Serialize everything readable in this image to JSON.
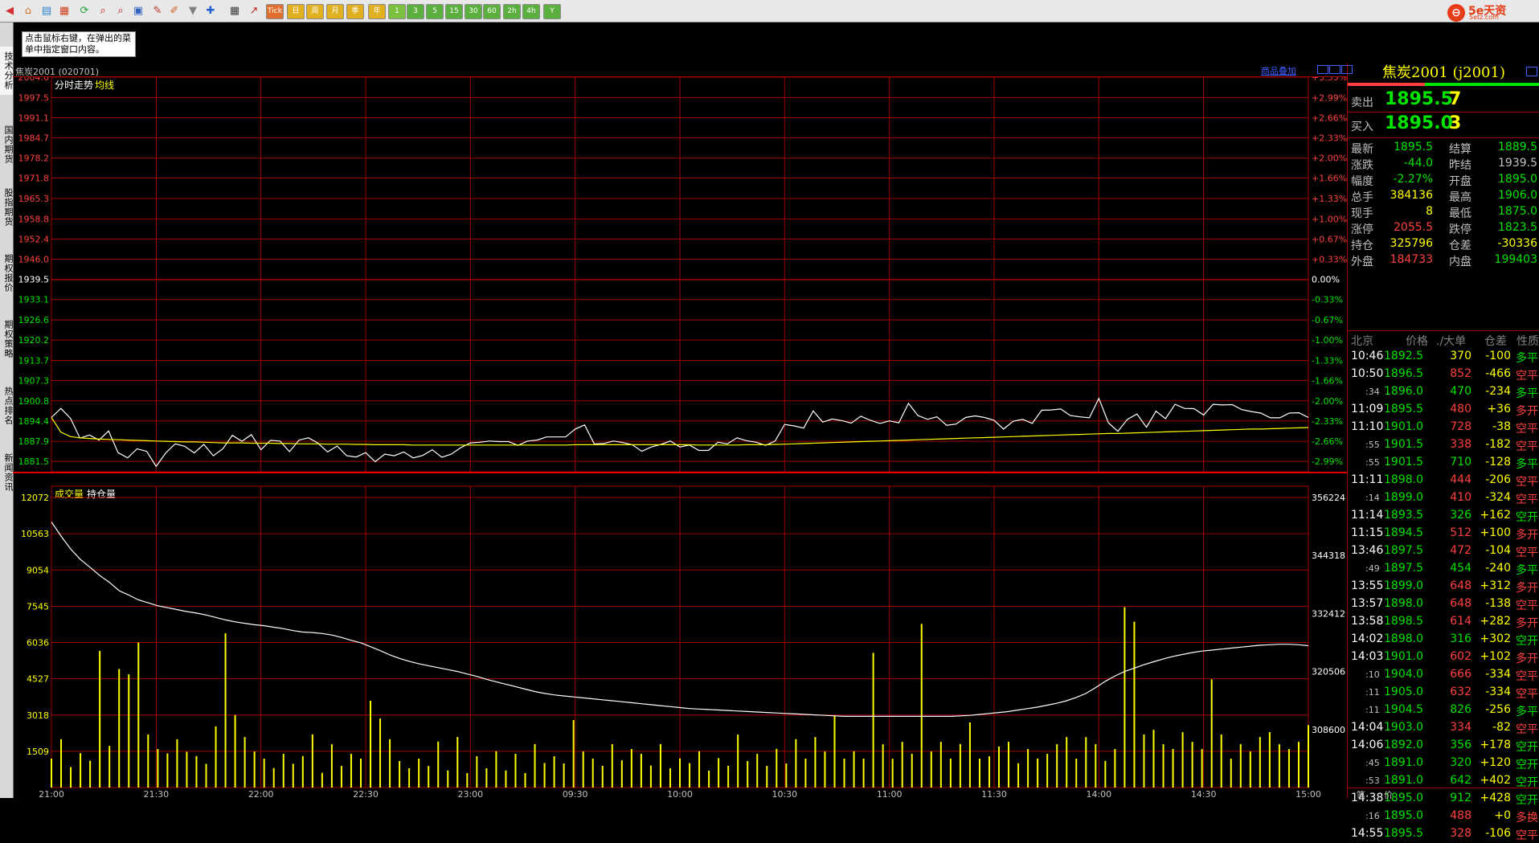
{
  "hint": "点击鼠标右键，在弹出的菜单中指定窗口内容。",
  "side_tabs": [
    "技术分析",
    "国内期货",
    "股指期货",
    "期权报价",
    "期权策略",
    "热点排名",
    "新闻资讯"
  ],
  "period_buttons": [
    "Tick",
    "日",
    "周",
    "月",
    "季",
    "年",
    "1",
    "3",
    "5",
    "15",
    "30",
    "60",
    "2h",
    "4h",
    "Y"
  ],
  "logo": {
    "text": "5e天资",
    "url": "5etz.com"
  },
  "symbol_title": "焦炭2001 (020701)",
  "overlay_link": "商品叠加",
  "price_chart": {
    "label_1": "分时走势",
    "label_2": "均线"
  },
  "volume_chart": {
    "label_1": "成交量",
    "label_2": "持仓量"
  },
  "chart_data": [
    {
      "type": "line",
      "title": "分时走势",
      "series": [
        {
          "name": "分时走势",
          "color": "#ffffff",
          "values": [
            1895.5,
            1898.4,
            1895.2,
            1888.9,
            1889.9,
            1888.3,
            1891.2,
            1884.3,
            1882.6,
            1885.5,
            1884.7,
            1879.9,
            1884.2,
            1887.1,
            1886.3,
            1884.2,
            1886.9,
            1883.3,
            1885.5,
            1889.8,
            1887.9,
            1890.0,
            1885.2,
            1888.2,
            1888.0,
            1884.6,
            1888.3,
            1889.0,
            1887.3,
            1884.5,
            1886.4,
            1883.3,
            1882.9,
            1884.3,
            1881.4,
            1883.8,
            1883.3,
            1884.5,
            1882.6,
            1883.4,
            1885.2,
            1882.8,
            1883.8,
            1885.9,
            1887.4,
            1887.6,
            1888.0,
            1887.8,
            1887.8,
            1886.6,
            1888.0,
            1888.3,
            1889.3,
            1889.3,
            1889.3,
            1891.8,
            1893.1,
            1887.1,
            1887.2,
            1888.0,
            1887.5,
            1886.8,
            1884.7,
            1886.1,
            1886.9,
            1888.0,
            1886.1,
            1886.7,
            1885.0,
            1885.0,
            1887.6,
            1887.1,
            1889.0,
            1888.1,
            1887.6,
            1886.6,
            1888.0,
            1893.3,
            1892.8,
            1892.1,
            1897.6,
            1894.0,
            1895.0,
            1894.5,
            1893.7,
            1895.9,
            1894.6,
            1893.6,
            1894.4,
            1893.8,
            1900.0,
            1896.1,
            1894.9,
            1895.7,
            1893.0,
            1893.4,
            1895.5,
            1896.0,
            1895.5,
            1894.6,
            1891.8,
            1894.3,
            1894.9,
            1893.6,
            1897.8,
            1897.9,
            1898.2,
            1896.1,
            1895.7,
            1895.4,
            1901.6,
            1893.8,
            1891.1,
            1894.9,
            1896.6,
            1892.4,
            1897.5,
            1895.1,
            1899.7,
            1898.4,
            1898.3,
            1896.3,
            1899.7,
            1899.5,
            1899.6,
            1898.0,
            1897.4,
            1896.9,
            1895.4,
            1895.4,
            1896.9,
            1897.0,
            1895.5
          ]
        },
        {
          "name": "均线",
          "color": "#ffff00",
          "values": [
            1895.5,
            1890.8,
            1889.4,
            1889.0,
            1888.8,
            1888.6,
            1888.5,
            1888.4,
            1888.3,
            1888.2,
            1888.1,
            1888.0,
            1887.9,
            1887.8,
            1887.7,
            1887.7,
            1887.6,
            1887.5,
            1887.4,
            1887.4,
            1887.4,
            1887.3,
            1887.3,
            1887.3,
            1887.2,
            1887.2,
            1887.1,
            1887.1,
            1887.1,
            1887.0,
            1887.0,
            1887.0,
            1886.9,
            1886.9,
            1886.8,
            1886.8,
            1886.8,
            1886.8,
            1886.7,
            1886.7,
            1886.7,
            1886.7,
            1886.7,
            1886.7,
            1886.7,
            1886.7,
            1886.7,
            1886.7,
            1886.7,
            1886.7,
            1886.7,
            1886.7,
            1886.7,
            1886.7,
            1886.7,
            1886.8,
            1886.8,
            1886.8,
            1886.8,
            1886.8,
            1886.8,
            1886.8,
            1886.8,
            1886.8,
            1886.8,
            1886.8,
            1886.8,
            1886.8,
            1886.7,
            1886.7,
            1886.7,
            1886.7,
            1886.7,
            1886.8,
            1886.8,
            1886.8,
            1886.9,
            1887.0,
            1887.1,
            1887.2,
            1887.3,
            1887.4,
            1887.5,
            1887.6,
            1887.7,
            1887.8,
            1887.9,
            1888.0,
            1888.1,
            1888.2,
            1888.3,
            1888.4,
            1888.5,
            1888.6,
            1888.7,
            1888.8,
            1888.9,
            1889.0,
            1889.1,
            1889.2,
            1889.3,
            1889.4,
            1889.5,
            1889.6,
            1889.7,
            1889.8,
            1889.9,
            1890.0,
            1890.1,
            1890.2,
            1890.3,
            1890.4,
            1890.4,
            1890.5,
            1890.6,
            1890.7,
            1890.8,
            1890.9,
            1891.0,
            1891.1,
            1891.2,
            1891.3,
            1891.4,
            1891.5,
            1891.6,
            1891.7,
            1891.8,
            1891.8,
            1891.9,
            1892.0,
            1892.1,
            1892.2,
            1892.3
          ]
        }
      ],
      "yticks_left": [
        "2004.0",
        "1997.5",
        "1991.1",
        "1984.7",
        "1978.2",
        "1971.8",
        "1965.3",
        "1958.8",
        "1952.4",
        "1946.0",
        "1939.5",
        "1933.1",
        "1926.6",
        "1920.2",
        "1913.7",
        "1907.3",
        "1900.8",
        "1894.4",
        "1887.9",
        "1881.5"
      ],
      "yticks_right": [
        "+3.33%",
        "+2.99%",
        "+2.66%",
        "+2.33%",
        "+2.00%",
        "+1.66%",
        "+1.33%",
        "+1.00%",
        "+0.67%",
        "+0.33%",
        "0.00%",
        "-0.33%",
        "-0.67%",
        "-1.00%",
        "-1.33%",
        "-1.66%",
        "-2.00%",
        "-2.33%",
        "-2.66%",
        "-2.99%"
      ],
      "ylim": [
        1878.2,
        2004.0
      ],
      "preclose": 1939.5
    },
    {
      "type": "bar",
      "title": "成交量",
      "yticks_left": [
        "12072",
        "10563",
        "9054",
        "7545",
        "6036",
        "4527",
        "3018",
        "1509"
      ],
      "yticks_right": [
        "356224",
        "344318",
        "332412",
        "320506",
        "308600"
      ],
      "volume_ylim": [
        0,
        12072
      ],
      "oi_ylim": [
        296694,
        356224
      ],
      "volume": [
        1205,
        2012,
        854,
        1432,
        1118,
        5690,
        1732,
        4932,
        4711,
        6036,
        2211,
        1603,
        1421,
        2011,
        1488,
        1312,
        986,
        2544,
        6420,
        3012,
        2104,
        1500,
        1201,
        812,
        1402,
        987,
        1312,
        2211,
        611,
        1802,
        901,
        1402,
        1204,
        3612,
        2871,
        2012,
        1104,
        803,
        1205,
        896,
        1912,
        712,
        2105,
        602,
        1303,
        804,
        1512,
        711,
        1401,
        603,
        1807,
        1022,
        1303,
        1004,
        2810,
        1501,
        1207,
        902,
        1806,
        1133,
        1604,
        1402,
        914,
        1807,
        801,
        1212,
        1016,
        1512,
        702,
        1224,
        904,
        2201,
        1103,
        1400,
        901,
        1612,
        1002,
        2017,
        1203,
        2104,
        1500,
        3003,
        1203,
        1508,
        1206,
        5607,
        1801,
        1200,
        1902,
        1404,
        6812,
        1500,
        1902,
        1204,
        1810,
        2707,
        1203,
        1301,
        1706,
        1904,
        1008,
        1604,
        1208,
        1401,
        1802,
        2103,
        1205,
        2101,
        1804,
        1107,
        1602,
        7506,
        6902,
        2206,
        2402,
        1804,
        1607,
        2303,
        1903,
        1603,
        4504,
        2209,
        1201,
        1808,
        1502,
        2102,
        2307,
        1802,
        1602,
        1903,
        2601
      ],
      "open_interest": [
        351200,
        348300,
        345600,
        343500,
        341900,
        340200,
        338800,
        337100,
        336200,
        335200,
        334600,
        334000,
        333600,
        333200,
        332800,
        332500,
        332100,
        331600,
        331100,
        330700,
        330400,
        330100,
        329900,
        329600,
        329300,
        328900,
        328600,
        328500,
        328300,
        328000,
        327500,
        326900,
        326400,
        325600,
        324800,
        323900,
        323200,
        322600,
        322100,
        321700,
        321300,
        320900,
        320500,
        320000,
        319500,
        318900,
        318400,
        317900,
        317400,
        316900,
        316400,
        316000,
        315700,
        315500,
        315300,
        315100,
        314900,
        314700,
        314500,
        314300,
        314100,
        313900,
        313700,
        313500,
        313300,
        313100,
        312900,
        312800,
        312700,
        312600,
        312500,
        312400,
        312300,
        312200,
        312100,
        312000,
        311900,
        311800,
        311700,
        311600,
        311500,
        311400,
        311300,
        311300,
        311300,
        311300,
        311300,
        311300,
        311300,
        311300,
        311300,
        311300,
        311300,
        311300,
        311400,
        311500,
        311700,
        311900,
        312100,
        312300,
        312600,
        312900,
        313200,
        313600,
        314000,
        314500,
        315200,
        316000,
        317200,
        318500,
        319600,
        320500,
        321200,
        321900,
        322500,
        323100,
        323600,
        324000,
        324400,
        324700,
        324900,
        325100,
        325300,
        325500,
        325700,
        325900,
        326000,
        326100,
        326100,
        326000,
        325800
      ]
    }
  ],
  "x_labels": [
    "21:00",
    "21:30",
    "22:00",
    "22:30",
    "23:00",
    "09:30",
    "10:00",
    "10:30",
    "11:00",
    "11:30",
    "14:00",
    "14:30",
    "15:00"
  ],
  "panel": {
    "title": "焦炭2001 (j2001)",
    "sell_label": "卖出",
    "sell_price": "1895.5",
    "sell_vol": "7",
    "buy_label": "买入",
    "buy_price": "1895.0",
    "buy_vol": "3",
    "stats": [
      {
        "l1": "最新",
        "v1": "1895.5",
        "c1": "#00e400",
        "l2": "结算",
        "v2": "1889.5",
        "c2": "#00e400"
      },
      {
        "l1": "涨跌",
        "v1": "-44.0",
        "c1": "#00e400",
        "l2": "昨结",
        "v2": "1939.5",
        "c2": "#c0c0c0"
      },
      {
        "l1": "幅度",
        "v1": "-2.27%",
        "c1": "#00e400",
        "l2": "开盘",
        "v2": "1895.0",
        "c2": "#00e400"
      },
      {
        "l1": "总手",
        "v1": "384136",
        "c1": "#ffff00",
        "l2": "最高",
        "v2": "1906.0",
        "c2": "#00e400"
      },
      {
        "l1": "现手",
        "v1": "8",
        "c1": "#ffff00",
        "l2": "最低",
        "v2": "1875.0",
        "c2": "#00e400"
      },
      {
        "l1": "涨停",
        "v1": "2055.5",
        "c1": "#ff4040",
        "l2": "跌停",
        "v2": "1823.5",
        "c2": "#00e400"
      },
      {
        "l1": "持仓",
        "v1": "325796",
        "c1": "#ffff00",
        "l2": "仓差",
        "v2": "-30336",
        "c2": "#ffff00"
      },
      {
        "l1": "外盘",
        "v1": "184733",
        "c1": "#ff4040",
        "l2": "内盘",
        "v2": "199403",
        "c2": "#00e400"
      }
    ],
    "tick_headers": [
      "北京",
      "价格",
      "./大单",
      "仓差",
      "性质"
    ],
    "ticks": [
      {
        "t": "10:46",
        "sub": false,
        "p": "1892.5",
        "pc": "#00e400",
        "v": "370",
        "vc": "#ffff00",
        "d": "-100",
        "n": "多平",
        "nc": "#00e400"
      },
      {
        "t": "10:50",
        "sub": false,
        "p": "1896.5",
        "pc": "#00e400",
        "v": "852",
        "vc": "#ff4040",
        "d": "-466",
        "n": "空平",
        "nc": "#ff4040"
      },
      {
        "t": ":34",
        "sub": true,
        "p": "1896.0",
        "pc": "#00e400",
        "v": "470",
        "vc": "#00e400",
        "d": "-234",
        "n": "多平",
        "nc": "#00e400"
      },
      {
        "t": "11:09",
        "sub": false,
        "p": "1895.5",
        "pc": "#00e400",
        "v": "480",
        "vc": "#ff4040",
        "d": "+36",
        "n": "多开",
        "nc": "#ff4040"
      },
      {
        "t": "11:10",
        "sub": false,
        "p": "1901.0",
        "pc": "#00e400",
        "v": "728",
        "vc": "#ff4040",
        "d": "-38",
        "n": "空平",
        "nc": "#ff4040"
      },
      {
        "t": ":55",
        "sub": true,
        "p": "1901.5",
        "pc": "#00e400",
        "v": "338",
        "vc": "#ff4040",
        "d": "-182",
        "n": "空平",
        "nc": "#ff4040"
      },
      {
        "t": ":55",
        "sub": true,
        "p": "1901.5",
        "pc": "#00e400",
        "v": "710",
        "vc": "#00e400",
        "d": "-128",
        "n": "多平",
        "nc": "#00e400"
      },
      {
        "t": "11:11",
        "sub": false,
        "p": "1898.0",
        "pc": "#00e400",
        "v": "444",
        "vc": "#ff4040",
        "d": "-206",
        "n": "空平",
        "nc": "#ff4040"
      },
      {
        "t": ":14",
        "sub": true,
        "p": "1899.0",
        "pc": "#00e400",
        "v": "410",
        "vc": "#ff4040",
        "d": "-324",
        "n": "空平",
        "nc": "#ff4040"
      },
      {
        "t": "11:14",
        "sub": false,
        "p": "1893.5",
        "pc": "#00e400",
        "v": "326",
        "vc": "#00e400",
        "d": "+162",
        "n": "空开",
        "nc": "#00e400"
      },
      {
        "t": "11:15",
        "sub": false,
        "p": "1894.5",
        "pc": "#00e400",
        "v": "512",
        "vc": "#ff4040",
        "d": "+100",
        "n": "多开",
        "nc": "#ff4040"
      },
      {
        "t": "13:46",
        "sub": false,
        "p": "1897.5",
        "pc": "#00e400",
        "v": "472",
        "vc": "#ff4040",
        "d": "-104",
        "n": "空平",
        "nc": "#ff4040"
      },
      {
        "t": ":49",
        "sub": true,
        "p": "1897.5",
        "pc": "#00e400",
        "v": "454",
        "vc": "#00e400",
        "d": "-240",
        "n": "多平",
        "nc": "#00e400"
      },
      {
        "t": "13:55",
        "sub": false,
        "p": "1899.0",
        "pc": "#00e400",
        "v": "648",
        "vc": "#ff4040",
        "d": "+312",
        "n": "多开",
        "nc": "#ff4040"
      },
      {
        "t": "13:57",
        "sub": false,
        "p": "1898.0",
        "pc": "#00e400",
        "v": "648",
        "vc": "#ff4040",
        "d": "-138",
        "n": "空平",
        "nc": "#ff4040"
      },
      {
        "t": "13:58",
        "sub": false,
        "p": "1898.5",
        "pc": "#00e400",
        "v": "614",
        "vc": "#ff4040",
        "d": "+282",
        "n": "多开",
        "nc": "#ff4040"
      },
      {
        "t": "14:02",
        "sub": false,
        "p": "1898.0",
        "pc": "#00e400",
        "v": "316",
        "vc": "#00e400",
        "d": "+302",
        "n": "空开",
        "nc": "#00e400"
      },
      {
        "t": "14:03",
        "sub": false,
        "p": "1901.0",
        "pc": "#00e400",
        "v": "602",
        "vc": "#ff4040",
        "d": "+102",
        "n": "多开",
        "nc": "#ff4040"
      },
      {
        "t": ":10",
        "sub": true,
        "p": "1904.0",
        "pc": "#00e400",
        "v": "666",
        "vc": "#ff4040",
        "d": "-334",
        "n": "空平",
        "nc": "#ff4040"
      },
      {
        "t": ":11",
        "sub": true,
        "p": "1905.0",
        "pc": "#00e400",
        "v": "632",
        "vc": "#ff4040",
        "d": "-334",
        "n": "空平",
        "nc": "#ff4040"
      },
      {
        "t": ":11",
        "sub": true,
        "p": "1904.5",
        "pc": "#00e400",
        "v": "826",
        "vc": "#00e400",
        "d": "-256",
        "n": "多平",
        "nc": "#00e400"
      },
      {
        "t": "14:04",
        "sub": false,
        "p": "1903.0",
        "pc": "#00e400",
        "v": "334",
        "vc": "#ff4040",
        "d": "-82",
        "n": "空平",
        "nc": "#ff4040"
      },
      {
        "t": "14:06",
        "sub": false,
        "p": "1892.0",
        "pc": "#00e400",
        "v": "356",
        "vc": "#00e400",
        "d": "+178",
        "n": "空开",
        "nc": "#00e400"
      },
      {
        "t": ":45",
        "sub": true,
        "p": "1891.0",
        "pc": "#00e400",
        "v": "320",
        "vc": "#00e400",
        "d": "+120",
        "n": "空开",
        "nc": "#00e400"
      },
      {
        "t": ":53",
        "sub": true,
        "p": "1891.0",
        "pc": "#00e400",
        "v": "642",
        "vc": "#00e400",
        "d": "+402",
        "n": "空开",
        "nc": "#00e400"
      },
      {
        "t": "14:38",
        "sub": false,
        "p": "1895.0",
        "pc": "#00e400",
        "v": "912",
        "vc": "#00e400",
        "d": "+428",
        "n": "空开",
        "nc": "#00e400"
      },
      {
        "t": ":16",
        "sub": true,
        "p": "1895.0",
        "pc": "#00e400",
        "v": "488",
        "vc": "#ff4040",
        "d": "+0",
        "n": "多换",
        "nc": "#ff4040"
      },
      {
        "t": "14:55",
        "sub": false,
        "p": "1895.5",
        "pc": "#00e400",
        "v": "328",
        "vc": "#ff4040",
        "d": "-106",
        "n": "空平",
        "nc": "#ff4040"
      }
    ],
    "bottom_tabs": [
      "笔",
      "价"
    ]
  },
  "colors": {
    "grid": "#a00000",
    "up": "#ff4040",
    "down": "#00e400",
    "avg": "#ffff00",
    "price": "#ffffff"
  }
}
